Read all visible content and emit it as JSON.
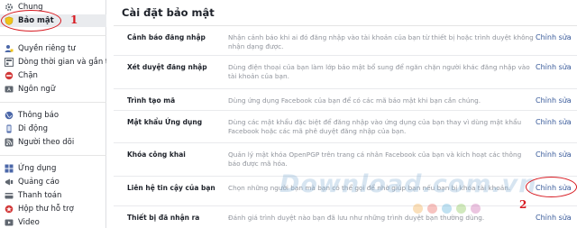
{
  "sidebar": {
    "items": [
      {
        "label": "Chung",
        "icon": "gear-icon"
      },
      {
        "label": "Bảo mật",
        "icon": "shield-icon",
        "active": true
      },
      {
        "label": "Quyền riêng tư",
        "icon": "lock-people-icon"
      },
      {
        "label": "Dòng thời gian và gắn t...",
        "icon": "timeline-icon"
      },
      {
        "label": "Chặn",
        "icon": "block-icon"
      },
      {
        "label": "Ngôn ngữ",
        "icon": "language-icon"
      },
      {
        "label": "Thông báo",
        "icon": "globe-icon"
      },
      {
        "label": "Di động",
        "icon": "mobile-icon"
      },
      {
        "label": "Người theo dõi",
        "icon": "rss-icon"
      },
      {
        "label": "Ứng dụng",
        "icon": "apps-icon"
      },
      {
        "label": "Quảng cáo",
        "icon": "ads-icon"
      },
      {
        "label": "Thanh toán",
        "icon": "card-icon"
      },
      {
        "label": "Hộp thư hỗ trợ",
        "icon": "support-icon"
      },
      {
        "label": "Video",
        "icon": "video-icon"
      }
    ]
  },
  "annotations": {
    "num1": "1",
    "num2": "2"
  },
  "main": {
    "title": "Cài đặt bảo mật",
    "rows": [
      {
        "label": "Cảnh báo đăng nhập",
        "desc": "Nhận cảnh báo khi ai đó đăng nhập vào tài khoản của bạn từ thiết bị hoặc trình duyệt không nhận dạng được.",
        "edit": "Chỉnh sửa"
      },
      {
        "label": "Xét duyệt đăng nhập",
        "desc": "Dùng điện thoại của bạn làm lớp bảo mật bổ sung để ngăn chặn người khác đăng nhập vào tài khoản của bạn.",
        "edit": "Chỉnh sửa"
      },
      {
        "label": "Trình tạo mã",
        "desc": "Dùng ứng dụng Facebook của bạn để có các mã bảo mật khi bạn cần chúng.",
        "edit": "Chỉnh sửa"
      },
      {
        "label": "Mật khẩu Ứng dụng",
        "desc": "Dùng các mật khẩu đặc biệt để đăng nhập vào ứng dụng của bạn thay vì dùng mật khẩu Facebook hoặc các mã phê duyệt đăng nhập của bạn.",
        "edit": "Chỉnh sửa"
      },
      {
        "label": "Khóa công khai",
        "desc": "Quản lý mật khóa OpenPGP trên trang cá nhân Facebook của bạn và kích hoạt các thông báo được mã hóa.",
        "edit": "Chỉnh sửa"
      },
      {
        "label": "Liên hệ tin cậy của bạn",
        "desc": "Chọn những người bạn mà bạn có thể gọi để nhờ giúp bạn nếu bạn bị khóa tài khoản.",
        "edit": "Chỉnh sửa"
      },
      {
        "label": "Thiết bị đã nhận ra",
        "desc": "Đánh giá trình duyệt nào bạn đã lưu như những trình duyệt bạn thường dùng.",
        "edit": "Chỉnh sửa"
      }
    ]
  },
  "watermark": {
    "text": "Download.com.vn",
    "dot_colors": [
      "#f1a33a",
      "#e8524a",
      "#4aa8d8",
      "#7ac143",
      "#c65aa6"
    ]
  }
}
